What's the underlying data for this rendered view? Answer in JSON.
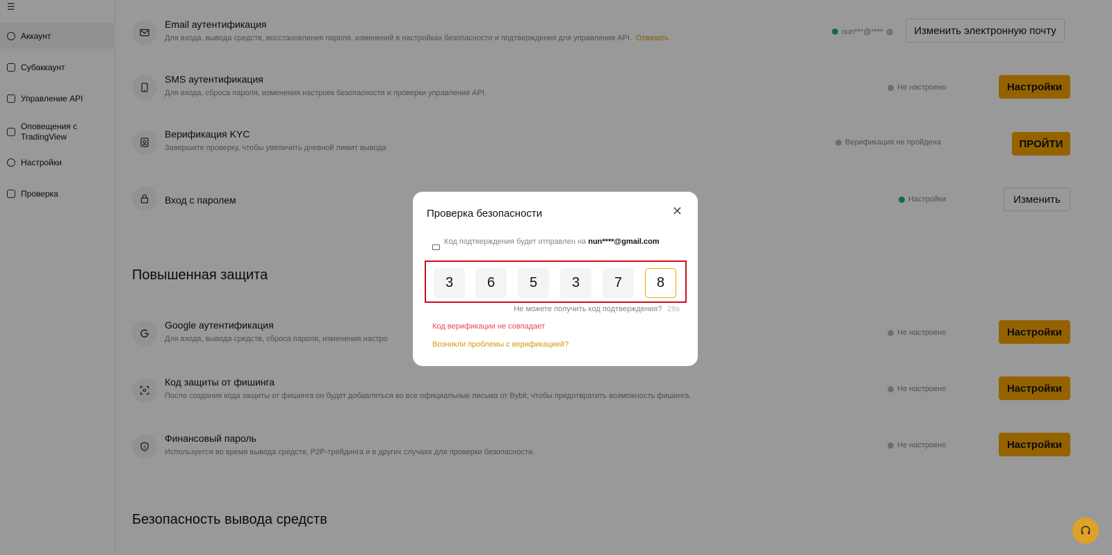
{
  "sidebar": {
    "items": [
      {
        "label": "Аккаунт"
      },
      {
        "label": "Субаккаунт"
      },
      {
        "label": "Управление API"
      },
      {
        "label": "Оповещения с TradingView"
      },
      {
        "label": "Настройки"
      },
      {
        "label": "Проверка"
      }
    ]
  },
  "rows": [
    {
      "title": "Email аутентификация",
      "desc": "Для входа, вывода средств, восстановления пароля, изменений в настройках безопасности и подтверждения для управления API.",
      "link": "Отвязать",
      "status": "nun***@****",
      "button": "Изменить электронную почту"
    },
    {
      "title": "SMS аутентификация",
      "desc": "Для входа, сброса пароля, изменения настроек безопасности и проверки управления API.",
      "status": "Не настроено",
      "button": "Настройки"
    },
    {
      "title": "Верификация KYC",
      "desc": "Завершите проверку, чтобы увеличить дневной лимит вывода",
      "status": "Верификация не пройдена",
      "button": "ПРОЙТИ"
    },
    {
      "title": "Вход с паролем",
      "desc": "",
      "status": "Настройки",
      "button": "Изменить"
    },
    {
      "title": "Google аутентификация",
      "desc": "Для входа, вывода средств, сброса пароля, изменения настро",
      "status": "Не настроено",
      "button": "Настройки"
    },
    {
      "title": "Код защиты от фишинга",
      "desc": "После создания кода защиты от фишинга он будет добавляться во все официальные письма от Bybit, чтобы предотвратить возможность фишинга.",
      "status": "Не настроено",
      "button": "Настройки"
    },
    {
      "title": "Финансовый пароль",
      "desc": "Используется во время вывода средств, P2P-трейдинга и в других случаях для проверки безопасности.",
      "status": "Не настроено",
      "button": "Настройки"
    }
  ],
  "sections": {
    "advanced": "Повышенная защита",
    "withdrawal": "Безопасность вывода средств"
  },
  "modal": {
    "title": "Проверка безопасности",
    "close": "✕",
    "info_prefix": "Код подтверждения будет отправлен на",
    "email": "nun****@gmail.com",
    "digits": [
      "3",
      "6",
      "5",
      "3",
      "7",
      "8"
    ],
    "resend": "Не можете получить код подтверждения?",
    "timer": "28s",
    "error": "Код верификации не совпадает",
    "help": "Возникли проблемы с верификацией?"
  },
  "colors": {
    "accent": "#f7a600",
    "error": "#e8455b",
    "highlight_frame": "#cc0f1c"
  }
}
